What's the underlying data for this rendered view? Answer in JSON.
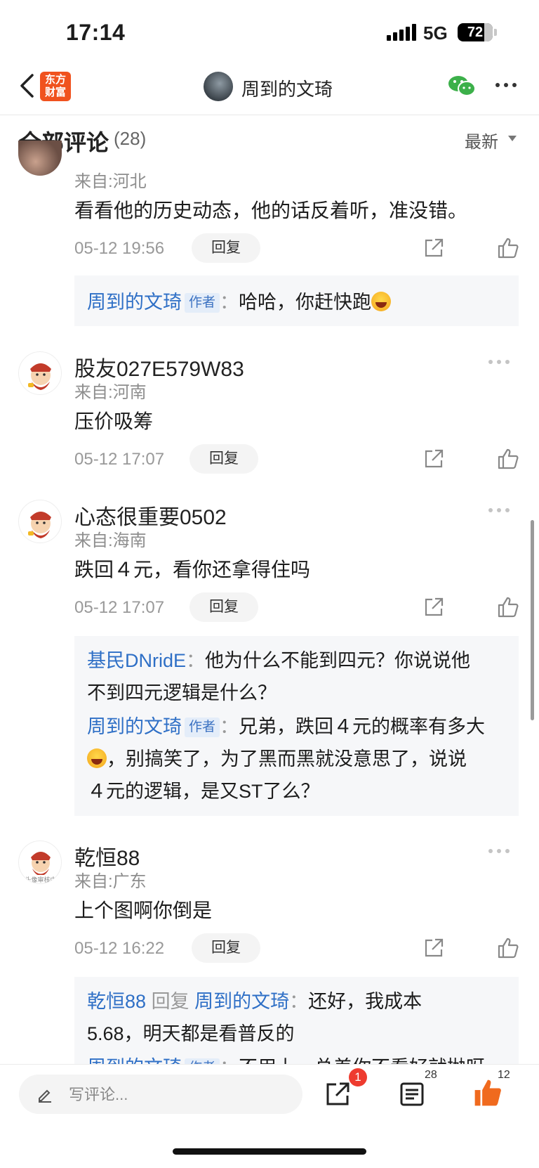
{
  "status_bar": {
    "time": "17:14",
    "network": "5G",
    "battery": "72"
  },
  "nav": {
    "logo_line1": "东方",
    "logo_line2": "财富",
    "title": "周到的文琦"
  },
  "header": {
    "title": "全部评论",
    "count": "(28)",
    "sort_label": "最新"
  },
  "comments": [
    {
      "location": "来自:河北",
      "text": "看看他的历史动态，他的话反着听，准没错。",
      "time": "05-12 19:56",
      "reply_label": "回复",
      "replies": [
        {
          "author": "周到的文琦",
          "tag": "作者",
          "text": "哈哈，你赶快跑",
          "emoji": "grinning-sweat-emoji"
        }
      ]
    },
    {
      "username": "股友027E579W83",
      "location": "来自:河南",
      "text": "压价吸筹",
      "time": "05-12 17:07",
      "reply_label": "回复"
    },
    {
      "username": "心态很重要0502",
      "location": "来自:海南",
      "text": "跌回４元，看你还拿得住吗",
      "time": "05-12 17:07",
      "reply_label": "回复",
      "replies": [
        {
          "author": "基民DNridE",
          "text_line1": "他为什么不能到四元？你说说他",
          "text_line2": "不到四元逻辑是什么？"
        },
        {
          "author": "周到的文琦",
          "tag": "作者",
          "text_line1": "兄弟，跌回４元的概率有多大",
          "text_line2": "，别搞笑了，为了黑而黑就没意思了，说说",
          "text_line3": "４元的逻辑，是又ST了么？",
          "emoji": "tears-of-joy-emoji"
        }
      ]
    },
    {
      "username": "乾恒88",
      "avatar_caption": "头像审核中",
      "location": "来自:广东",
      "text": "上个图啊你倒是",
      "time": "05-12 16:22",
      "reply_label": "回复",
      "replies": [
        {
          "author": "乾恒88",
          "reply_word": "回复",
          "target": "周到的文琦",
          "text_line1": "还好，我成本",
          "text_line2": "5.68，明天都是看普反的"
        },
        {
          "author": "周到的文琦",
          "tag": "作者",
          "text_partial": "不用上，总差你不看好就抛呀"
        }
      ]
    }
  ],
  "bottom_bar": {
    "placeholder": "写评论...",
    "share_badge": "1",
    "comment_count": "28",
    "like_count": "12"
  },
  "colors": {
    "accent_blue": "#2e6fc6",
    "like_orange": "#f06a1e",
    "badge_red": "#ee3b2f",
    "logo_orange": "#f0521e"
  }
}
